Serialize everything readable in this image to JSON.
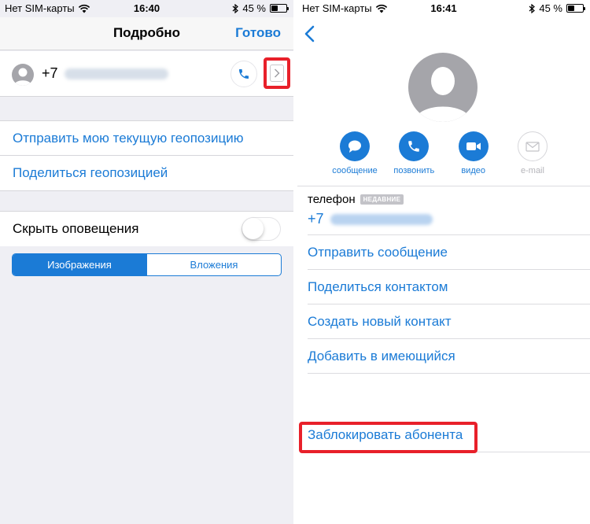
{
  "left_screen": {
    "status": {
      "carrier": "Нет SIM-карты",
      "time": "16:40",
      "battery": "45 %",
      "battery_level": 0.45
    },
    "nav": {
      "title": "Подробно",
      "done": "Готово"
    },
    "contact": {
      "phone_prefix": "+7"
    },
    "location_actions": [
      {
        "label": "Отправить мою текущую геопозицию"
      },
      {
        "label": "Поделиться геопозицией"
      }
    ],
    "hide_alerts": {
      "label": "Скрыть оповещения",
      "on": false
    },
    "segments": [
      {
        "label": "Изображения",
        "active": true
      },
      {
        "label": "Вложения",
        "active": false
      }
    ]
  },
  "right_screen": {
    "status": {
      "carrier": "Нет SIM-карты",
      "time": "16:41",
      "battery": "45 %",
      "battery_level": 0.45
    },
    "actions": [
      {
        "label": "сообщение",
        "icon": "message-icon",
        "enabled": true
      },
      {
        "label": "позвонить",
        "icon": "phone-icon",
        "enabled": true
      },
      {
        "label": "видео",
        "icon": "video-icon",
        "enabled": true
      },
      {
        "label": "e-mail",
        "icon": "mail-icon",
        "enabled": false
      }
    ],
    "phone": {
      "label": "телефон",
      "badge": "НЕДАВНИЕ",
      "prefix": "+7"
    },
    "list": [
      {
        "label": "Отправить сообщение"
      },
      {
        "label": "Поделиться контактом"
      },
      {
        "label": "Создать новый контакт"
      },
      {
        "label": "Добавить в имеющийся"
      }
    ],
    "block": {
      "label": "Заблокировать абонента"
    }
  },
  "colors": {
    "accent": "#1b7bd6",
    "highlight": "#e8202a",
    "grouped_bg": "#efeff4",
    "avatar": "#a5a5aa"
  }
}
